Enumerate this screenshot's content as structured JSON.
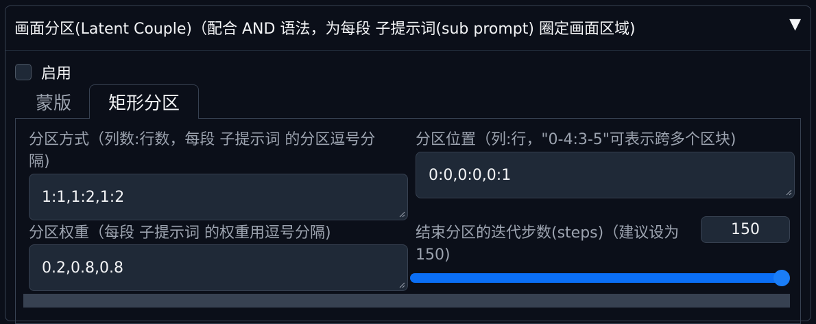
{
  "panel": {
    "title": "画面分区(Latent Couple)（配合 AND 语法，为每段 子提示词(sub prompt) 圈定画面区域)",
    "toggle_icon": "▼"
  },
  "enable": {
    "label": "启用",
    "checked": false
  },
  "tabs": [
    {
      "label": "蒙版",
      "active": false
    },
    {
      "label": "矩形分区",
      "active": true
    }
  ],
  "fields": {
    "divisions": {
      "label_line1": "分区方式（列数:行数，每段 子提示词 的分区逗号分",
      "label_line2": "隔)",
      "value": "1:1,1:2,1:2"
    },
    "positions": {
      "label": "分区位置（列:行，\"0-4:3-5\"可表示跨多个区块)",
      "value": "0:0,0:0,0:1"
    },
    "weights": {
      "label": "分区权重（每段 子提示词 的权重用逗号分隔)",
      "value": "0.2,0.8,0.8"
    },
    "end_steps": {
      "label_line1": "结束分区的迭代步数(steps)（建议设为",
      "label_line2": "150)",
      "value": "150",
      "slider_fraction": 1.0
    }
  },
  "colors": {
    "background": "#0b0f19",
    "input_bg": "#1f2937",
    "border": "#374151",
    "accent": "#0b6ff6"
  }
}
